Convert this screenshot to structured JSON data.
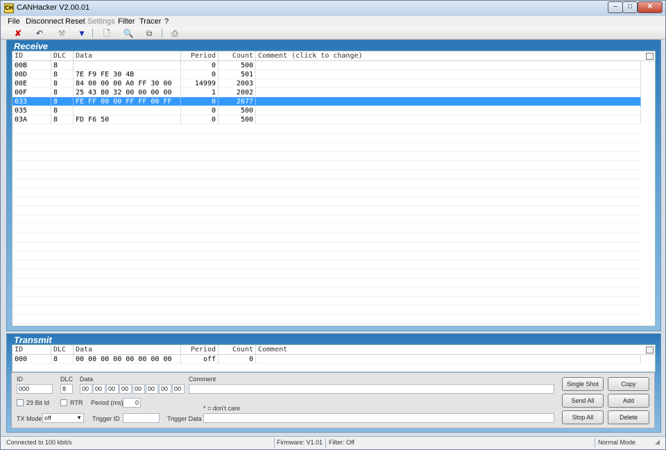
{
  "window": {
    "title": "CANHacker V2.00.01",
    "icon_text": "CH"
  },
  "menu": [
    "File",
    "Disconnect",
    "Reset",
    "Settings",
    "Filter",
    "Tracer",
    "?"
  ],
  "receive": {
    "title": "Receive",
    "headers": [
      "ID",
      "DLC",
      "Data",
      "Period",
      "Count",
      "Comment (click to change)"
    ],
    "rows": [
      {
        "id": "00B",
        "dlc": "8",
        "data": "",
        "period": "0",
        "count": "500",
        "comment": ""
      },
      {
        "id": "00D",
        "dlc": "8",
        "data": "7E F9 FE 30 4B",
        "period": "0",
        "count": "501",
        "comment": ""
      },
      {
        "id": "00E",
        "dlc": "8",
        "data": "84 00 00 00 A0 FF 30 00",
        "period": "14999",
        "count": "2003",
        "comment": ""
      },
      {
        "id": "00F",
        "dlc": "8",
        "data": "25 43 80 32 00 00 00 00",
        "period": "1",
        "count": "2002",
        "comment": ""
      },
      {
        "id": "033",
        "dlc": "8",
        "data": "FE FF 00 00 FF FF 00 FF",
        "period": "0",
        "count": "2677",
        "comment": "",
        "selected": true
      },
      {
        "id": "035",
        "dlc": "8",
        "data": "",
        "period": "0",
        "count": "500",
        "comment": ""
      },
      {
        "id": "03A",
        "dlc": "8",
        "data": "FD F6 50",
        "period": "0",
        "count": "500",
        "comment": ""
      }
    ]
  },
  "transmit": {
    "title": "Transmit",
    "headers": [
      "ID",
      "DLC",
      "Data",
      "Period",
      "Count",
      "Comment"
    ],
    "rows": [
      {
        "id": "000",
        "dlc": "8",
        "data": "00 00 00 00 00 00 00 00",
        "period": "off",
        "count": "0",
        "comment": ""
      }
    ]
  },
  "form": {
    "id_label": "ID",
    "id_value": "000",
    "dlc_label": "DLC",
    "dlc_value": "8",
    "data_label": "Data",
    "data_bytes": [
      "00",
      "00",
      "00",
      "00",
      "00",
      "00",
      "00",
      "00"
    ],
    "comment_label": "Comment",
    "comment_value": "",
    "bit29_label": "29 Bit Id",
    "rtr_label": "RTR",
    "period_label": "Period (ms)",
    "period_value": "0",
    "dont_care": "* = don't care",
    "txmode_label": "TX Mode",
    "txmode_value": "off",
    "trigger_id_label": "Trigger ID",
    "trigger_id_value": "",
    "trigger_data_label": "Trigger Data",
    "trigger_data_value": "",
    "buttons": [
      "Single Shot",
      "Copy",
      "Send All",
      "Add",
      "Stop All",
      "Delete"
    ]
  },
  "status": {
    "connection": "Connected to 100 kbit/s",
    "firmware": "Firmware: V1.01",
    "filter": "Filter: Off",
    "mode": "Normal Mode"
  }
}
